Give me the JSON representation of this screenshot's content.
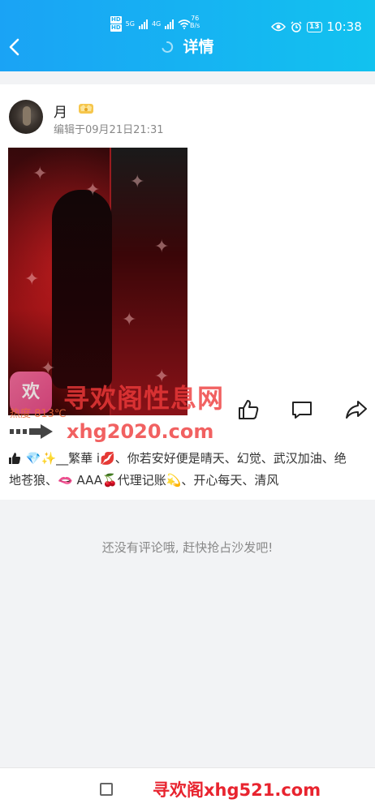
{
  "status_bar": {
    "network_badges": [
      "HD",
      "HD"
    ],
    "signal_labels": [
      "5G",
      "4G"
    ],
    "speed_value": "76",
    "speed_unit": "B/s",
    "battery": "13",
    "time": "10:38"
  },
  "header": {
    "title": "详情"
  },
  "post": {
    "author": "月",
    "edited": "编辑于09月21日21:31",
    "hot_text": "热度 813℃",
    "likers_text": "💎✨__繁華 i💋、你若安好便是晴天、幻觉、武汉加油、绝地苍狼、🫦 AAA🍒代理记账💫、开心每天、清风"
  },
  "watermark": {
    "site_name": "寻欢阁性息网",
    "url": "xhg2020.com",
    "logo_text": "欢"
  },
  "comments": {
    "empty_text": "还没有评论哦, 赶快抢占沙发吧!"
  },
  "footer": {
    "watermark": "寻欢阁xhg521.com"
  },
  "colors": {
    "header_start": "#1aa3f5",
    "header_end": "#12c2ef",
    "watermark_red": "#ee3a3a"
  }
}
